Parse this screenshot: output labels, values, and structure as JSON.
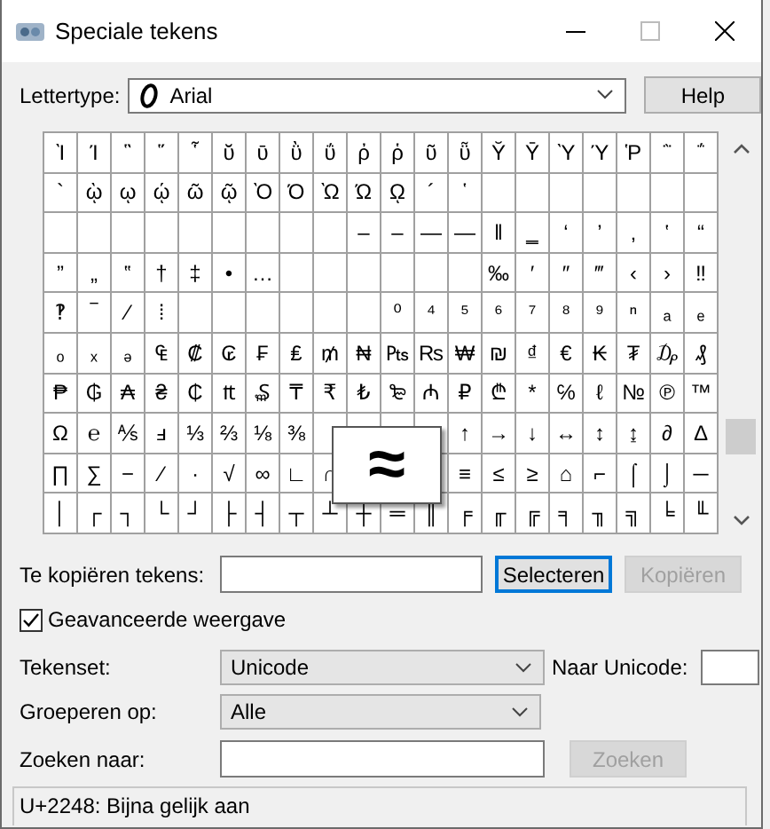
{
  "window": {
    "title": "Speciale tekens"
  },
  "font": {
    "label": "Lettertype:",
    "value": "Arial"
  },
  "help_button": {
    "label": "Help"
  },
  "grid": {
    "rows": [
      [
        "Ὶ",
        "Ί",
        "῝",
        "῞",
        "῟",
        "ῠ",
        "ῡ",
        "ῢ",
        "ΰ",
        "ῤ",
        "ῥ",
        "ῦ",
        "ῧ",
        "Ῠ",
        "Ῡ",
        "Ὺ",
        "Ύ",
        "Ῥ",
        "῭",
        "΅"
      ],
      [
        "`",
        "ῲ",
        "ῳ",
        "ῴ",
        "ῶ",
        "ῷ",
        "Ὸ",
        "Ό",
        "Ὼ",
        "Ώ",
        "ῼ",
        "´",
        "῾",
        null,
        null,
        null,
        null,
        null,
        null,
        null
      ],
      [
        null,
        null,
        null,
        null,
        null,
        null,
        null,
        null,
        null,
        "‒",
        "–",
        "—",
        "―",
        "‖",
        "‗",
        "‘",
        "’",
        "‚",
        "‛",
        "“"
      ],
      [
        "”",
        "„",
        "‟",
        "†",
        "‡",
        "•",
        "…",
        null,
        null,
        null,
        null,
        null,
        null,
        "‰",
        "′",
        "″",
        "‴",
        "‹",
        "›",
        "‼"
      ],
      [
        "‽",
        "‾",
        "⁄",
        "⁞",
        null,
        null,
        null,
        null,
        null,
        null,
        "⁰",
        "⁴",
        "⁵",
        "⁶",
        "⁷",
        "⁸",
        "⁹",
        "ⁿ",
        "ₐ",
        "ₑ"
      ],
      [
        "ₒ",
        "ₓ",
        "ₔ",
        "₠",
        "₡",
        "₢",
        "₣",
        "₤",
        "₥",
        "₦",
        "₧",
        "₨",
        "₩",
        "₪",
        "₫",
        "€",
        "₭",
        "₮",
        "₯",
        "₰"
      ],
      [
        "₱",
        "₲",
        "₳",
        "₴",
        "₵",
        "₶",
        "₷",
        "₸",
        "₹",
        "₺",
        "₻",
        "₼",
        "₽",
        "₾",
        "*",
        "℅",
        "ℓ",
        "№",
        "℗",
        "™"
      ],
      [
        "Ω",
        "℮",
        "⅍",
        "ⅎ",
        "⅓",
        "⅔",
        "⅛",
        "⅜",
        null,
        null,
        null,
        null,
        "↑",
        "→",
        "↓",
        "↔",
        "↕",
        "↨",
        "∂",
        "∆"
      ],
      [
        "∏",
        "∑",
        "−",
        "∕",
        "∙",
        "√",
        "∞",
        "∟",
        "∩",
        null,
        null,
        null,
        "≡",
        "≤",
        "≥",
        "⌂",
        "⌐",
        "⌠",
        "⌡",
        "─"
      ],
      [
        "│",
        "┌",
        "┐",
        "└",
        "┘",
        "├",
        "┤",
        "┬",
        "┴",
        "┼",
        "═",
        "║",
        "╒",
        "╓",
        "╔",
        "╕",
        "╖",
        "╗",
        "╘",
        "╙"
      ]
    ],
    "enlarged": "≈"
  },
  "copy": {
    "label": "Te kopiëren tekens:",
    "buttons": [
      {
        "label": "Selecteren",
        "disabled": false
      },
      {
        "label": "Kopiëren",
        "disabled": true
      }
    ]
  },
  "advanced": {
    "label": "Geavanceerde weergave",
    "checked": true
  },
  "charset": {
    "label": "Tekenset:",
    "value": "Unicode",
    "goto_label": "Naar Unicode:"
  },
  "group_by": {
    "label": "Groeperen op:",
    "value": "Alle"
  },
  "search": {
    "label": "Zoeken naar:",
    "button": {
      "label": "Zoeken",
      "disabled": true
    }
  },
  "status_bar": "U+2248: Bijna gelijk aan"
}
